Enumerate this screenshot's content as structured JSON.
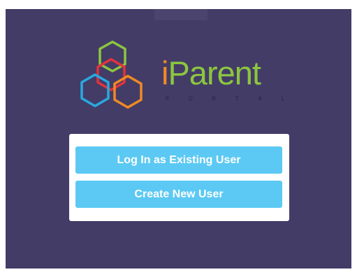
{
  "brand": {
    "prefix": "i",
    "name": "Parent",
    "subtitle_letters": [
      "P",
      "O",
      "R",
      "T",
      "A",
      "L"
    ]
  },
  "buttons": {
    "login_label": "Log In as Existing User",
    "create_label": "Create New User"
  },
  "colors": {
    "background": "#433c67",
    "button": "#5bc9f3",
    "brand_i": "#f08a24",
    "brand_text": "#8cc63f",
    "hex_green": "#8cc63f",
    "hex_red": "#e2333d",
    "hex_blue": "#29a9e0",
    "hex_orange": "#f08a24"
  },
  "icons": {
    "logo": "hexagon-cluster-logo-icon"
  }
}
